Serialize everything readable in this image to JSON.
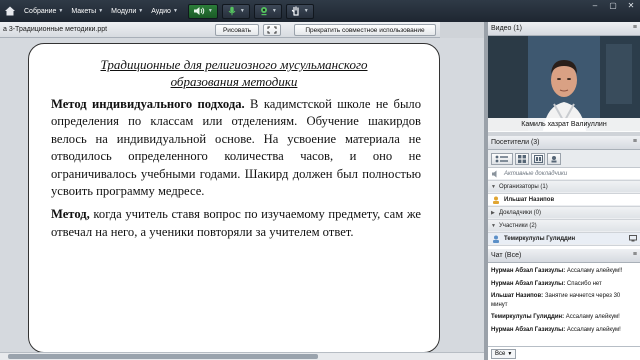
{
  "menu": {
    "items": [
      {
        "label": "Собрание"
      },
      {
        "label": "Макеты"
      },
      {
        "label": "Модули"
      },
      {
        "label": "Аудио"
      }
    ]
  },
  "share": {
    "title": "а 3-Традиционные  методики.ppt",
    "draw_label": "Рисовать",
    "stop_label": "Прекратить совместное использование"
  },
  "slide": {
    "title_line1": "Традиционные для религиозного мусульманского",
    "title_line2": "образования методики",
    "p1_head": "Метод индивидуального подхода.",
    "p1_text": " В кадимстской школе не было определения по классам или отделениям. Обучение шакирдов велось на индивидуальной основе. На усвоение материала не отводилось определенного количества часов, и оно не ограничивалось учебными годами. Шакирд должен был полностью усвоить программу медресе.",
    "p2_head": "Метод,",
    "p2_text": " когда  учитель ставя вопрос по изучаемому предмету, сам же отвечал на него, а ученики повторяли за учителем ответ."
  },
  "video": {
    "header": "Видео",
    "count": "(1)",
    "caption": "Камиль хазрат Валиуллин"
  },
  "attendees": {
    "header": "Посетители",
    "count": "(3)",
    "active_speakers": "Активные докладчики",
    "organizers_label": "Организаторы (1)",
    "organizer_name": "Ильшат Назипов",
    "presenters_label": "Докладчики (0)",
    "participants_label": "Участники (2)",
    "participant_name": "Темиркулулы Гулиддин"
  },
  "chat": {
    "header": "Чат",
    "count": "(Все)",
    "messages": [
      {
        "who": "Нурман Абзал Газизулы:",
        "text": " Ассаламу алейкум!!"
      },
      {
        "who": "Нурман Абзал Газизулы:",
        "text": " Спасибо нет"
      },
      {
        "who": "Ильшат Назипов:",
        "text": " Занятие начнется через 30 минут"
      },
      {
        "who": "Темиркулулы Гулиддин:",
        "text": " Ассаламу алейкум!"
      },
      {
        "who": "Нурман Абзал Газизулы:",
        "text": " Ассаламу алейкум!"
      }
    ],
    "target_label": "Все"
  }
}
